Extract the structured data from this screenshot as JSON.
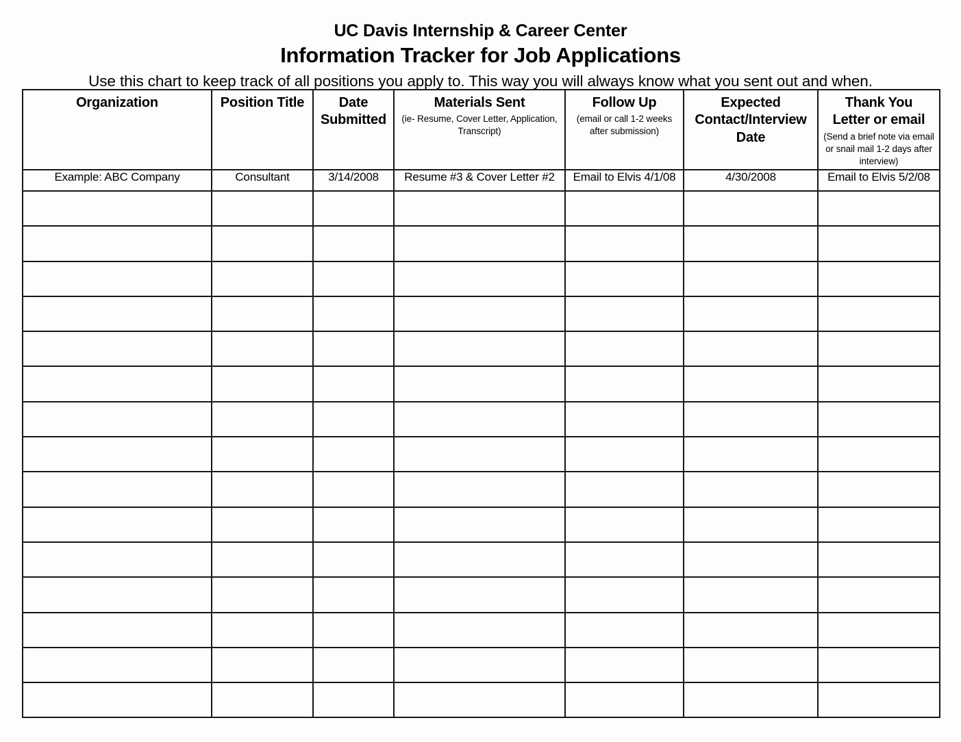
{
  "document": {
    "org_title": "UC Davis Internship & Career Center",
    "doc_title": "Information Tracker for Job Applications",
    "subtitle": "Use this chart to keep track of all positions you apply to.  This way you will always know what you sent out and when."
  },
  "table": {
    "columns": [
      {
        "heading": "Organization",
        "subheading": ""
      },
      {
        "heading": "Position Title",
        "subheading": ""
      },
      {
        "heading": "Date\nSubmitted",
        "subheading": ""
      },
      {
        "heading": "Materials Sent",
        "subheading": "(ie- Resume, Cover Letter, Application, Transcript)"
      },
      {
        "heading": "Follow Up",
        "subheading": "(email or call 1-2 weeks after submission)"
      },
      {
        "heading": "Expected\nContact/Interview\nDate",
        "subheading": ""
      },
      {
        "heading": "Thank You\nLetter or email",
        "subheading": "(Send a brief note via email or snail mail 1-2 days after interview)"
      }
    ],
    "headings": {
      "organization": "Organization",
      "position_title": "Position Title",
      "date_submitted_line1": "Date",
      "date_submitted_line2": "Submitted",
      "materials_sent": "Materials Sent",
      "materials_sent_sub": "(ie- Resume, Cover Letter, Application, Transcript)",
      "follow_up": "Follow Up",
      "follow_up_sub": "(email or call 1-2 weeks after submission)",
      "expected_line1": "Expected",
      "expected_line2": "Contact/Interview",
      "expected_line3": "Date",
      "thank_you_line1": "Thank You",
      "thank_you_line2": "Letter or email",
      "thank_you_sub": "(Send a brief note via email or snail mail 1-2 days after interview)"
    },
    "example_row": {
      "organization": "Example: ABC Company",
      "position_title": "Consultant",
      "date_submitted": "3/14/2008",
      "materials_sent": "Resume #3 & Cover Letter #2",
      "follow_up": "Email to Elvis 4/1/08",
      "expected_date": "4/30/2008",
      "thank_you": "Email to Elvis 5/2/08"
    },
    "blank_row_count": 15,
    "blank_cell_value": ""
  },
  "colors": {
    "border": "#171717",
    "page_background": "#fdfdfd",
    "text": "#000000"
  }
}
